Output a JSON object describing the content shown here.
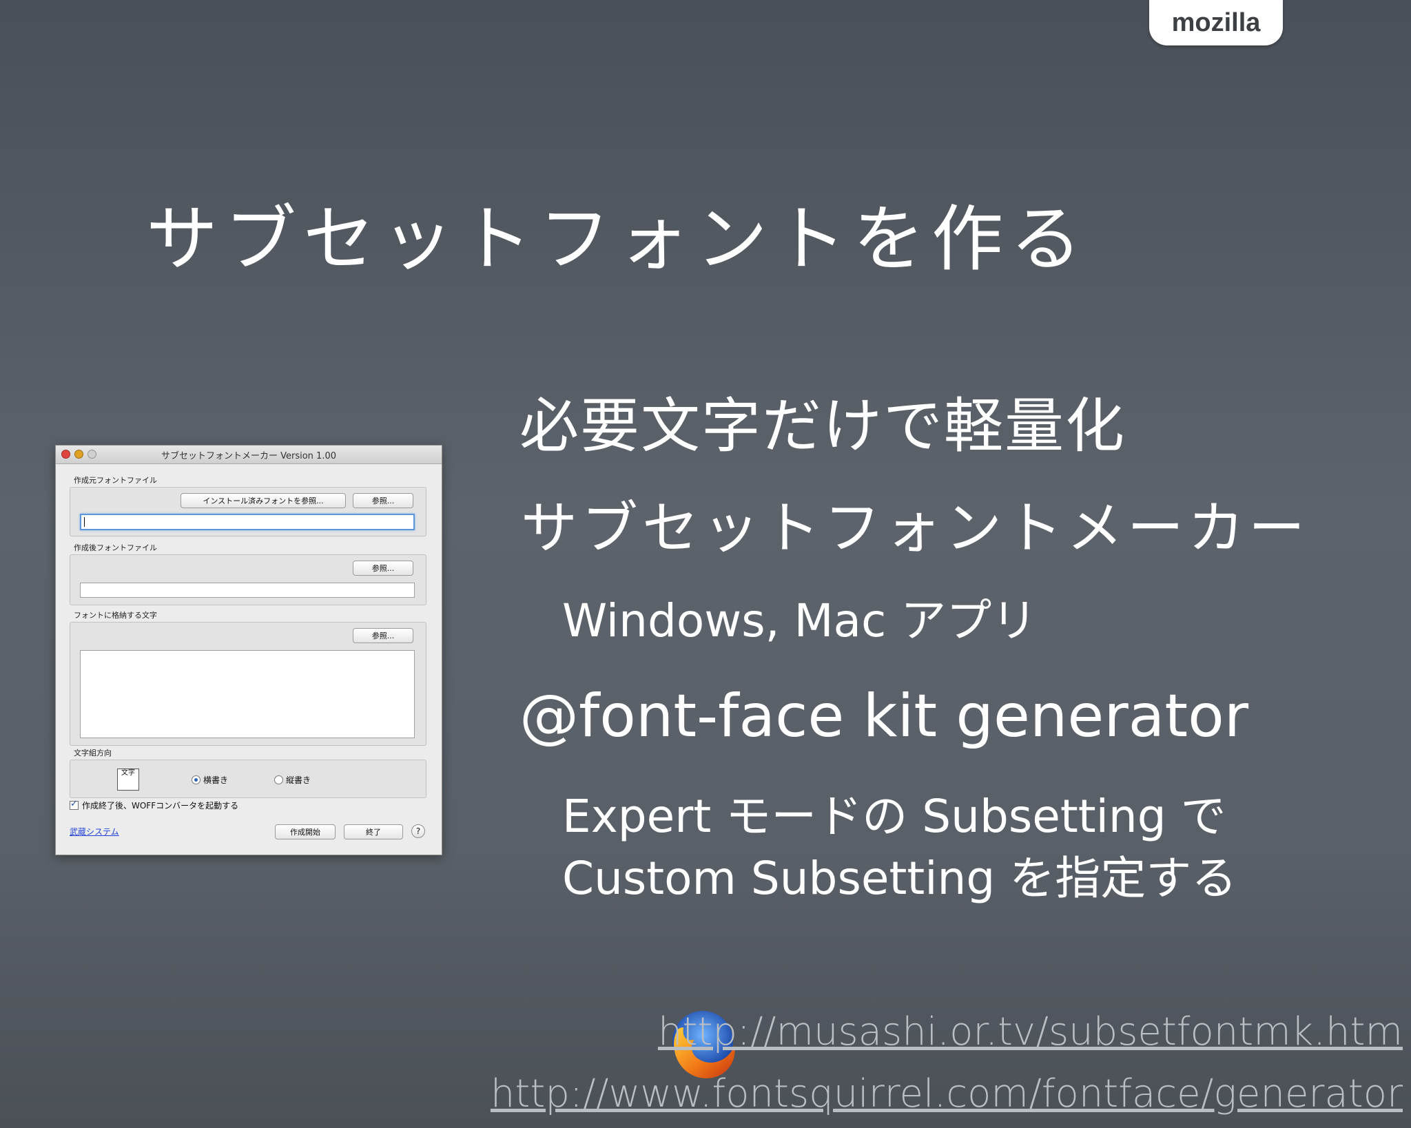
{
  "brand": {
    "tab_label": "mozilla"
  },
  "slide": {
    "title": "サブセットフォントを作る",
    "bullets": {
      "b1": "必要文字だけで軽量化",
      "b2": "サブセットフォントメーカー",
      "b3": "Windows, Mac アプリ",
      "b4": "@font-face kit generator",
      "b5": "Expert モードの Subsetting で",
      "b6": "Custom Subsetting を指定する"
    },
    "links": {
      "url1": "http://musashi.or.tv/subsetfontmk.htm",
      "url2": "http://www.fontsquirrel.com/fontface/generator"
    }
  },
  "app": {
    "window_title": "サブセットフォントメーカー Version 1.00",
    "source_label": "作成元フォントファイル",
    "installed_button": "インストール済みフォントを参照...",
    "browse_button": "参照...",
    "dest_label": "作成後フォントファイル",
    "chars_label": "フォントに格納する文字",
    "direction_label": "文字組方向",
    "direction_icon_text": "文字",
    "horizontal": "横書き",
    "vertical": "縦書き",
    "woff_check": "作成終了後、WOFFコンバータを起動する",
    "musashi_link": "武蔵システム",
    "start_button": "作成開始",
    "exit_button": "終了",
    "help": "?"
  },
  "colors": {
    "background": "#585e66",
    "link_gray": "#b9bec4",
    "mac_link_blue": "#1f3fd6"
  }
}
